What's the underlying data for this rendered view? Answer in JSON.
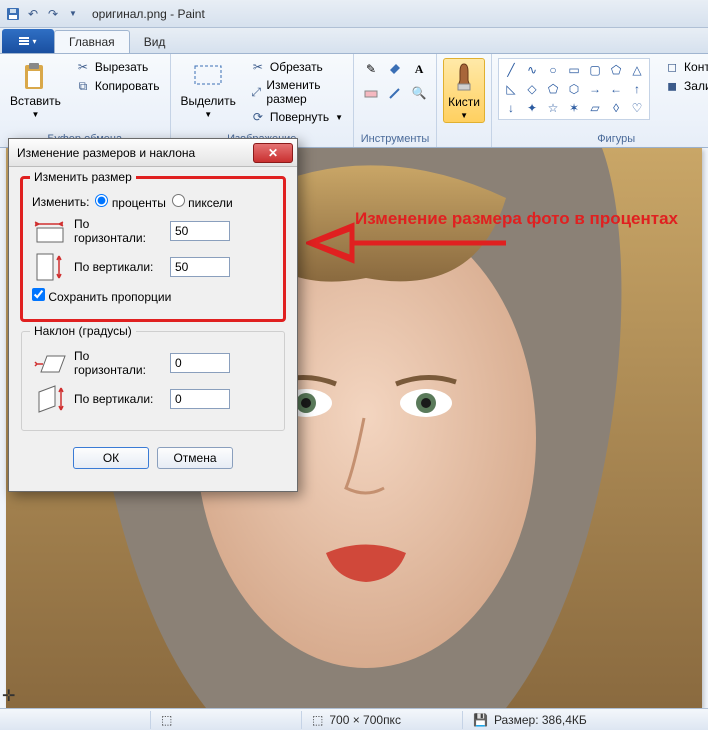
{
  "title": "оригинал.png - Paint",
  "tabs": {
    "file_dropdown": "▾",
    "home": "Главная",
    "view": "Вид"
  },
  "ribbon": {
    "clipboard": {
      "label": "Буфер обмена",
      "paste": "Вставить",
      "cut": "Вырезать",
      "copy": "Копировать"
    },
    "image": {
      "label": "Изображение",
      "select": "Выделить",
      "crop": "Обрезать",
      "resize": "Изменить размер",
      "rotate": "Повернуть"
    },
    "tools": {
      "label": "Инструменты"
    },
    "brushes": {
      "label": "Кисти"
    },
    "shapes": {
      "label": "Фигуры",
      "outline": "Контур",
      "fill": "Заливка"
    }
  },
  "dialog": {
    "title": "Изменение размеров и наклона",
    "resize": {
      "legend": "Изменить размер",
      "change_by": "Изменить:",
      "percent": "проценты",
      "pixels": "пиксели",
      "horizontal": "По горизонтали:",
      "vertical": "По вертикали:",
      "h_value": "50",
      "v_value": "50",
      "keep_ratio": "Сохранить пропорции"
    },
    "skew": {
      "legend": "Наклон (градусы)",
      "horizontal": "По горизонтали:",
      "vertical": "По вертикали:",
      "h_value": "0",
      "v_value": "0"
    },
    "ok": "ОК",
    "cancel": "Отмена"
  },
  "annotation": "Изменение размера фото в процентах",
  "status": {
    "dims": "700 × 700пкс",
    "size": "Размер: 386,4КБ"
  }
}
